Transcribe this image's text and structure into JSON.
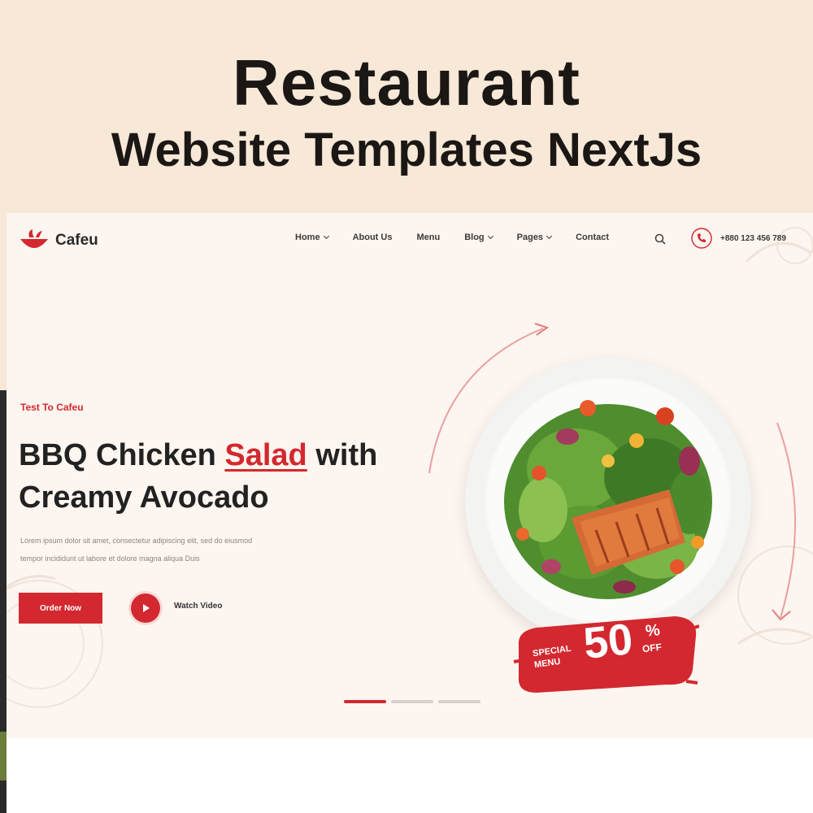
{
  "banner": {
    "title": "Restaurant",
    "subtitle": "Website Templates NextJs"
  },
  "nav": {
    "logo": "Cafeu",
    "menu": [
      {
        "label": "Home",
        "has_dropdown": true
      },
      {
        "label": "About Us",
        "has_dropdown": false
      },
      {
        "label": "Menu",
        "has_dropdown": false
      },
      {
        "label": "Blog",
        "has_dropdown": true
      },
      {
        "label": "Pages",
        "has_dropdown": true
      },
      {
        "label": "Contact",
        "has_dropdown": false
      }
    ],
    "phone": "+880 123 456 789",
    "icons": {
      "search": "search-icon",
      "phone": "phone-icon"
    }
  },
  "hero": {
    "eyebrow": "Test To Cafeu",
    "headline_part1": "BBQ Chicken ",
    "headline_accent": "Salad",
    "headline_part2": " with",
    "headline_line2": "Creamy Avocado",
    "description_line1": "Lorem ipsum dolor sit amet, consectetur adipiscing elit, sed do eiusmod",
    "description_line2": "tempor incididunt ut labore et dolore magna aliqua Duis",
    "order_button": "Order Now",
    "watch_label": "Watch Video"
  },
  "badge": {
    "line1": "SPECIAL",
    "line2": "MENU",
    "number": "50",
    "percent": "%",
    "off": "OFF"
  },
  "slider": {
    "active_index": 0,
    "count": 3
  },
  "colors": {
    "accent": "#d3282f",
    "banner_bg": "#f8e8d8",
    "hero_bg": "#fdf5ef",
    "text_dark": "#222222"
  }
}
